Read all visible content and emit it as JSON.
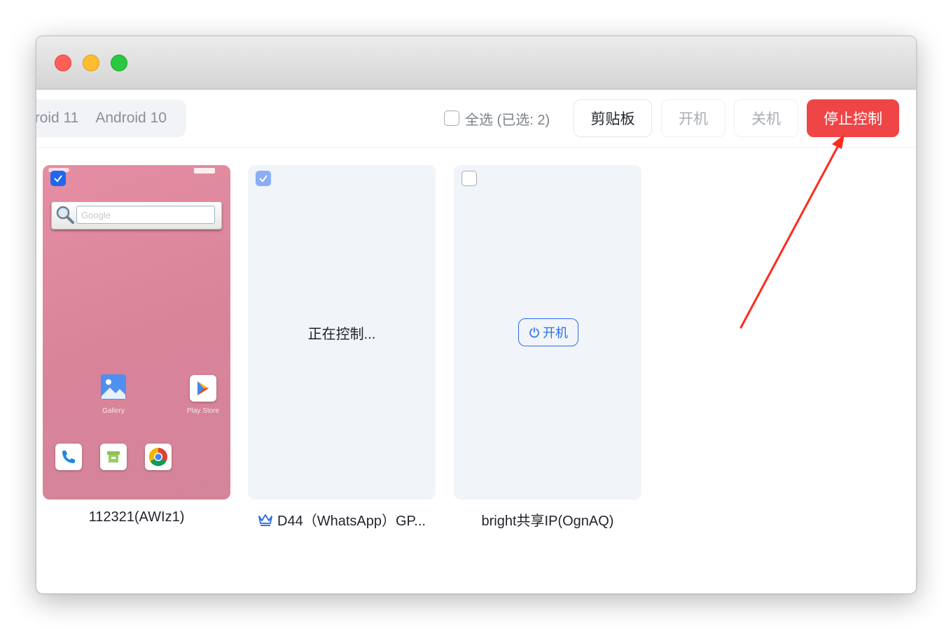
{
  "toolbar": {
    "tabs": [
      "droid 11",
      "Android 10"
    ],
    "select_all_label": "全选 (已选: 2)",
    "clipboard_label": "剪贴板",
    "power_on_label": "开机",
    "power_off_label": "关机",
    "stop_control_label": "停止控制"
  },
  "devices": [
    {
      "label": "112321(AWIz1)",
      "checked": true,
      "screen": {
        "search_placeholder": "Google",
        "apps": [
          "Gallery",
          "Play Store"
        ]
      }
    },
    {
      "label": "D44（WhatsApp）GP...",
      "checked": true,
      "status": "正在控制...",
      "vip": true
    },
    {
      "label": "bright共享IP(OgnAQ)",
      "checked": false,
      "power_button_label": "开机"
    }
  ],
  "colors": {
    "accent": "#1f66f0",
    "danger": "#ef4547",
    "annotation_arrow": "#ff2a1a"
  }
}
